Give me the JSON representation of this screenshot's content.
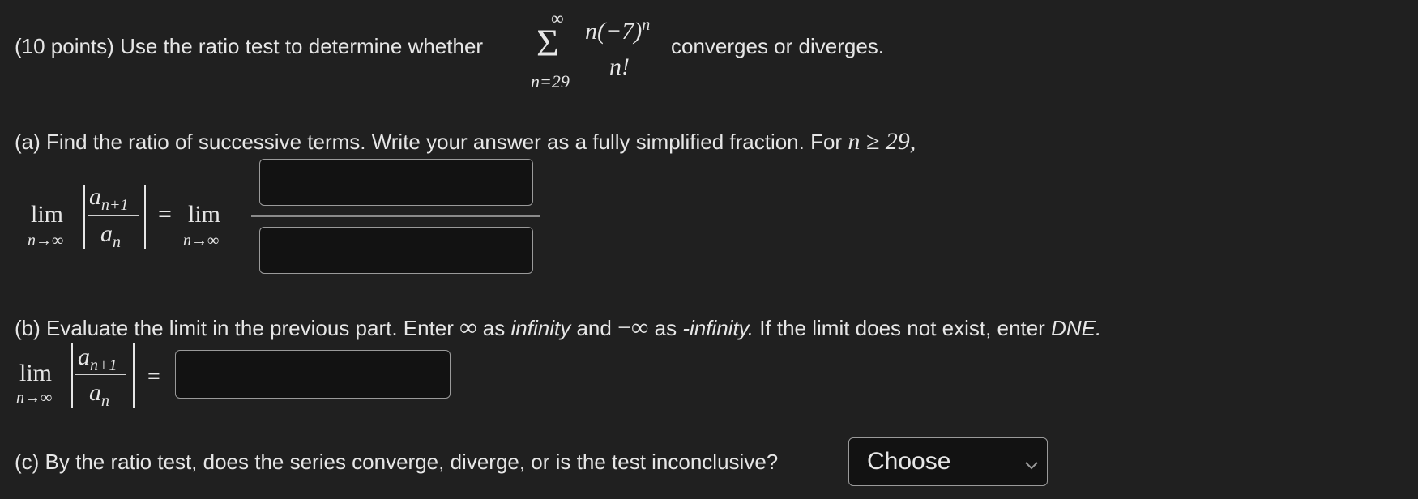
{
  "question": {
    "intro": "(10 points) Use the ratio test to determine whether",
    "outro": "converges or diverges.",
    "sum_upper": "∞",
    "sum_symbol": "Σ",
    "sum_lower": "n=29",
    "term_numerator": "n(−7)",
    "term_numerator_sup": "n",
    "term_denominator": "n!"
  },
  "part_a": {
    "text": "(a) Find the ratio of successive terms. Write your answer as a fully simplified fraction. For",
    "condition": "n ≥ 29,",
    "lim": "lim",
    "lim_sub": "n→∞",
    "ratio_num": "a",
    "ratio_num_sub": "n+1",
    "ratio_den": "a",
    "ratio_den_sub": "n",
    "equals": "=",
    "lim2": "lim",
    "lim2_sub": "n→∞",
    "numerator_value": "",
    "denominator_value": ""
  },
  "part_b": {
    "text_1": "(b) Evaluate the limit in the previous part. Enter",
    "inf_symbol": "∞",
    "text_2": "as",
    "infinity_word": "infinity",
    "text_3": "and",
    "neg_inf_symbol": "−∞",
    "text_4": "as",
    "neg_infinity_word": "-infinity.",
    "text_5": "If the limit does not exist, enter",
    "dne_word": "DNE.",
    "lim": "lim",
    "lim_sub": "n→∞",
    "ratio_num": "a",
    "ratio_num_sub": "n+1",
    "ratio_den": "a",
    "ratio_den_sub": "n",
    "equals": "=",
    "answer_value": ""
  },
  "part_c": {
    "text": "(c) By the ratio test, does the series converge, diverge, or is the test inconclusive?",
    "select_value": "Choose",
    "chevron_icon": "chevron-down-icon"
  }
}
